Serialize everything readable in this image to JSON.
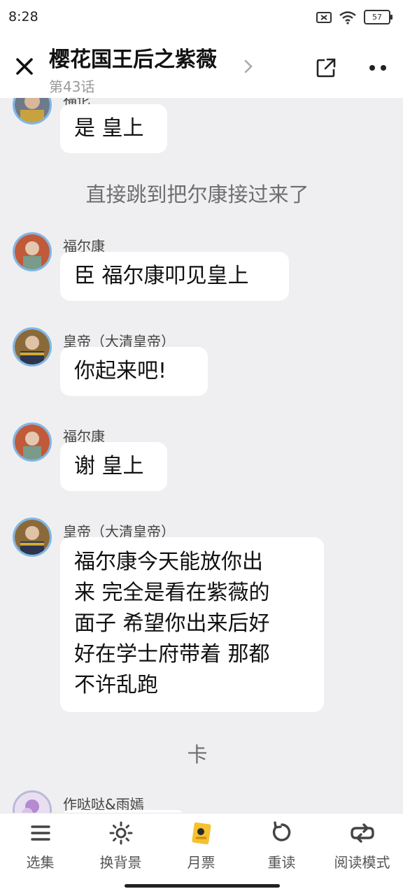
{
  "status": {
    "time": "8:28",
    "battery": "57"
  },
  "header": {
    "title": "樱花国王后之紫薇",
    "episode": "第43话"
  },
  "messages": [
    {
      "name": "福伦",
      "text": "是 皇上"
    },
    {
      "narration": "直接跳到把尔康接过来了"
    },
    {
      "name": "福尔康",
      "text": "臣 福尔康叩见皇上"
    },
    {
      "name": "皇帝（大清皇帝）",
      "text": "你起来吧!"
    },
    {
      "name": "福尔康",
      "text": "谢 皇上"
    },
    {
      "name": "皇帝（大清皇帝）",
      "lines": [
        "福尔康今天能放你出",
        "来 完全是看在紫薇的",
        "面子  希望你出来后好",
        "好在学士府带着 那都",
        "不许乱跑"
      ]
    },
    {
      "narration": "卡"
    },
    {
      "name": "作哒哒&雨嫣"
    }
  ],
  "tabs": [
    {
      "label": "选集",
      "icon": "list-icon"
    },
    {
      "label": "换背景",
      "icon": "sun-icon"
    },
    {
      "label": "月票",
      "icon": "ticket-icon"
    },
    {
      "label": "重读",
      "icon": "refresh-icon"
    },
    {
      "label": "阅读模式",
      "icon": "loop-icon"
    }
  ],
  "colors": {
    "accent_avatar_ring": "#7fb7e6",
    "ticket": "#f5c12e",
    "background": "#efeff1"
  }
}
